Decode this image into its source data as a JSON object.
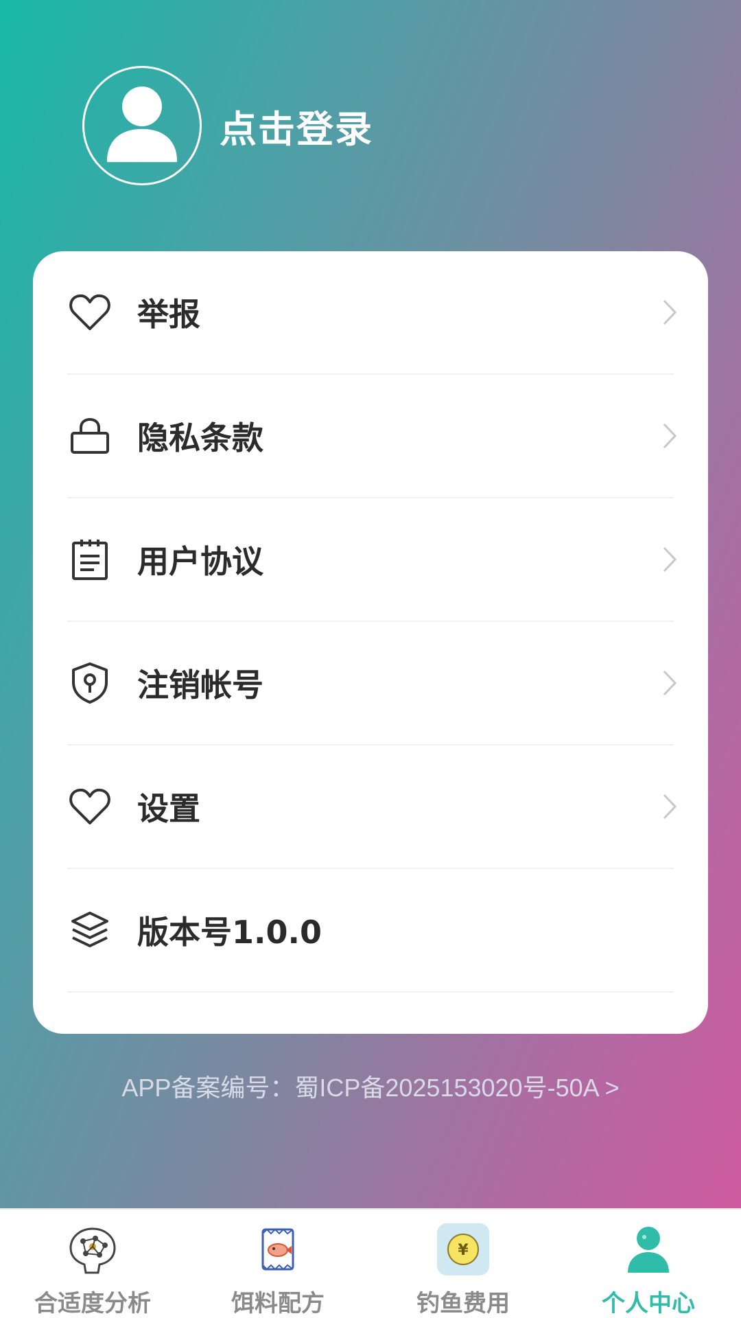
{
  "profile": {
    "login_text": "点击登录"
  },
  "menu": {
    "items": [
      {
        "label": "举报",
        "icon": "heart-icon"
      },
      {
        "label": "隐私条款",
        "icon": "lock-icon"
      },
      {
        "label": "用户协议",
        "icon": "clipboard-icon"
      },
      {
        "label": "注销帐号",
        "icon": "shield-icon"
      },
      {
        "label": "设置",
        "icon": "heart-icon"
      },
      {
        "label": "版本号1.0.0",
        "icon": "layers-icon"
      }
    ]
  },
  "footer": {
    "icp": "APP备案编号：蜀ICP备2025153020号-50A  >"
  },
  "tabbar": {
    "tabs": [
      {
        "label": "合适度分析",
        "icon": "analysis-icon"
      },
      {
        "label": "饵料配方",
        "icon": "bait-icon"
      },
      {
        "label": "钓鱼费用",
        "icon": "coin-icon"
      },
      {
        "label": "个人中心",
        "icon": "person-icon",
        "active": true
      }
    ]
  },
  "colors": {
    "accent": "#2fbca9",
    "gradient_start": "#17b8a6",
    "gradient_end": "#d4589e"
  }
}
